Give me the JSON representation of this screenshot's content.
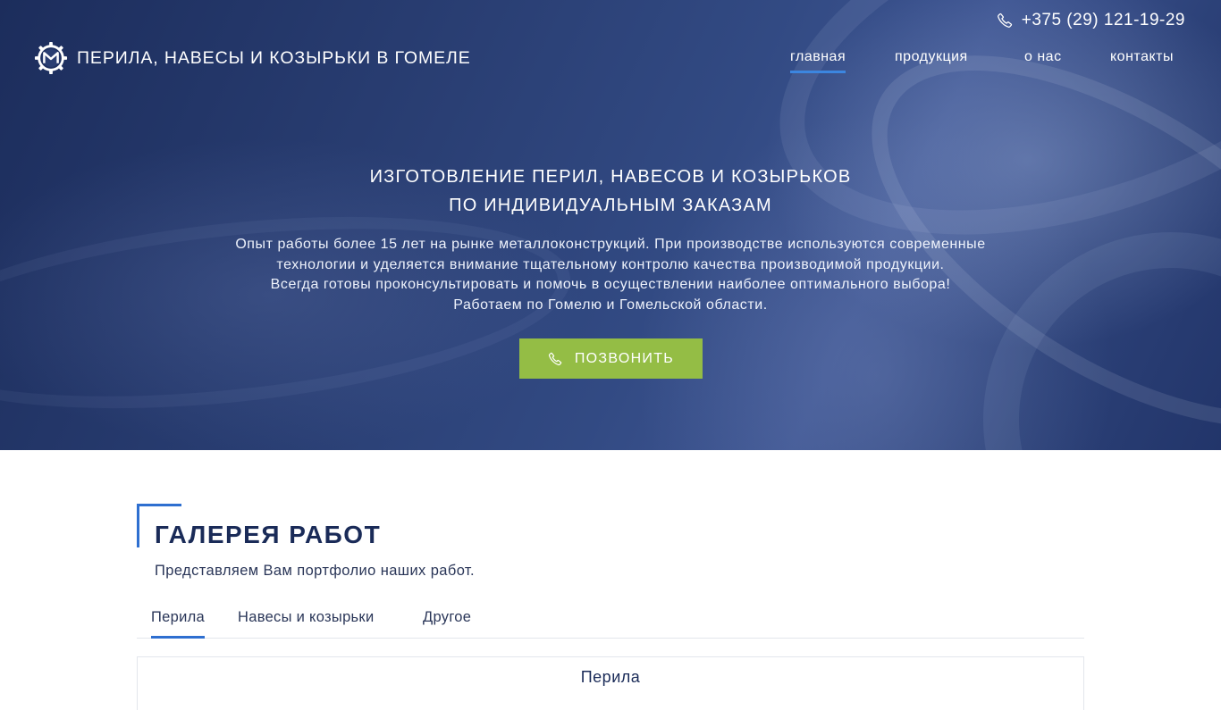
{
  "header": {
    "site_title": "ПЕРИЛА, НАВЕСЫ И КОЗЫРЬКИ В ГОМЕЛЕ",
    "logo_icon": "gear-m-logo-icon",
    "phone": "+375 (29) 121-19-29",
    "phone_icon": "phone-icon"
  },
  "nav": {
    "items": [
      {
        "label": "главная",
        "active": true
      },
      {
        "label": "продукция",
        "active": false
      },
      {
        "label": "о нас",
        "active": false
      },
      {
        "label": "контакты",
        "active": false
      }
    ],
    "active_color": "#3c86e0"
  },
  "hero": {
    "heading_line1": "ИЗГОТОВЛЕНИЕ ПЕРИЛ, НАВЕСОВ И КОЗЫРЬКОВ",
    "heading_line2": "ПО ИНДИВИДУАЛЬНЫМ ЗАКАЗАМ",
    "text_lines": [
      "Опыт работы более 15 лет на рынке металлоконструкций. При производстве используются современные",
      "технологии и уделяется внимание тщательному контролю качества производимой продукции.",
      "Всегда готовы проконсультировать и помочь в осуществлении наиболее оптимального выбора!",
      "Работаем по Гомелю и Гомельской области."
    ],
    "call_button_label": "ПОЗВОНИТЬ",
    "call_button_color": "#94bd45"
  },
  "gallery": {
    "title": "ГАЛЕРЕЯ РАБОТ",
    "subtitle": "Представляем Вам портфолио наших работ.",
    "accent_color": "#2e6fd0",
    "tabs": [
      {
        "label": "Перила",
        "active": true
      },
      {
        "label": "Навесы и козырьки",
        "active": false
      },
      {
        "label": "Другое",
        "active": false
      }
    ],
    "panel_title": "Перила"
  }
}
